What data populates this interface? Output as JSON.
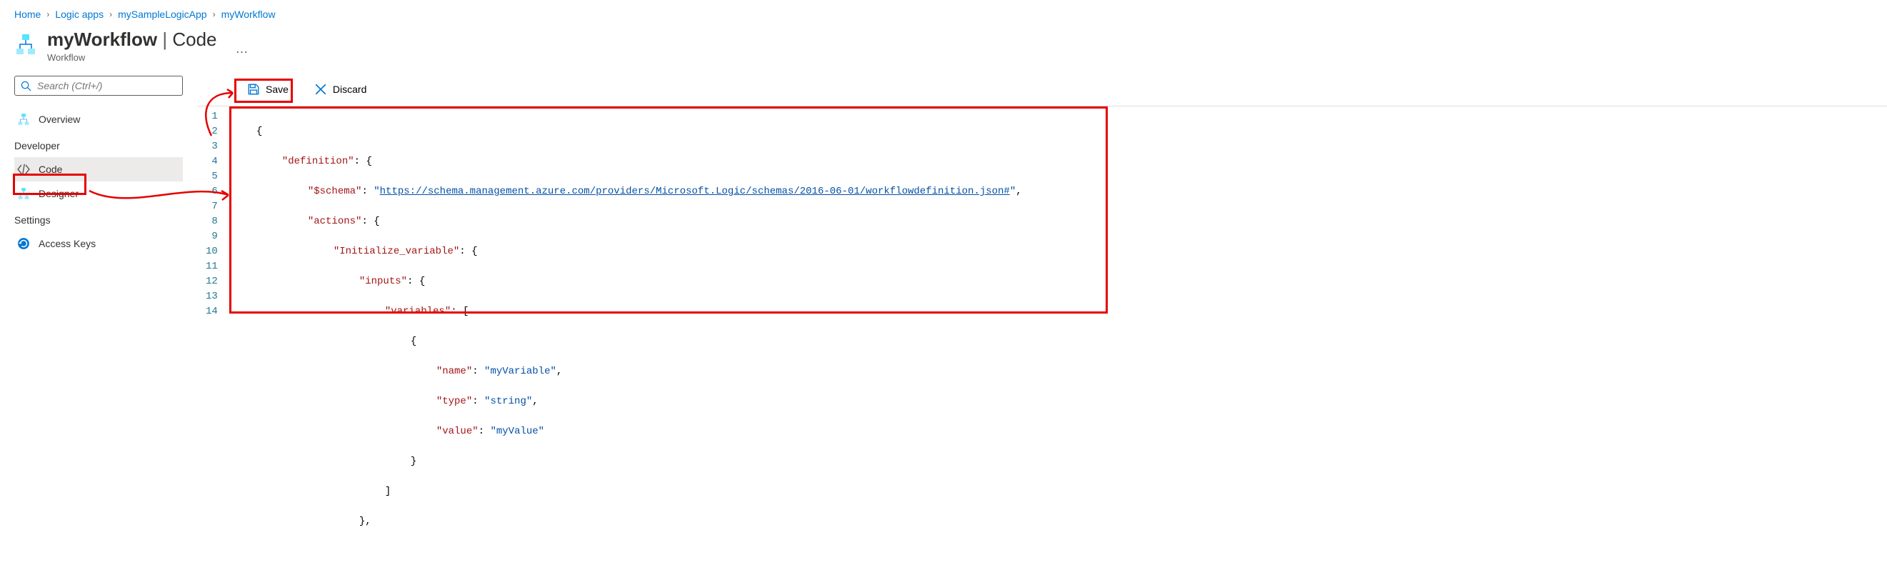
{
  "breadcrumb": {
    "home": "Home",
    "logicapps": "Logic apps",
    "app": "mySampleLogicApp",
    "workflow": "myWorkflow"
  },
  "header": {
    "title": "myWorkflow",
    "section": "Code",
    "subtitle": "Workflow",
    "more": "…"
  },
  "search": {
    "placeholder": "Search (Ctrl+/)"
  },
  "sidebar": {
    "overview": "Overview",
    "group_developer": "Developer",
    "code": "Code",
    "designer": "Designer",
    "group_settings": "Settings",
    "access_keys": "Access Keys"
  },
  "toolbar": {
    "save": "Save",
    "discard": "Discard"
  },
  "code": {
    "schema_url": "https://schema.management.azure.com/providers/Microsoft.Logic/schemas/2016-06-01/workflowdefinition.json#",
    "var_name": "myVariable",
    "var_type": "string",
    "var_value": "myValue",
    "action_name": "Initialize_variable",
    "keys": {
      "definition": "definition",
      "schema": "$schema",
      "actions": "actions",
      "inputs": "inputs",
      "variables": "variables",
      "name": "name",
      "type": "type",
      "value": "value"
    }
  },
  "line_numbers": [
    "1",
    "2",
    "3",
    "4",
    "5",
    "6",
    "7",
    "8",
    "9",
    "10",
    "11",
    "12",
    "13",
    "14"
  ]
}
